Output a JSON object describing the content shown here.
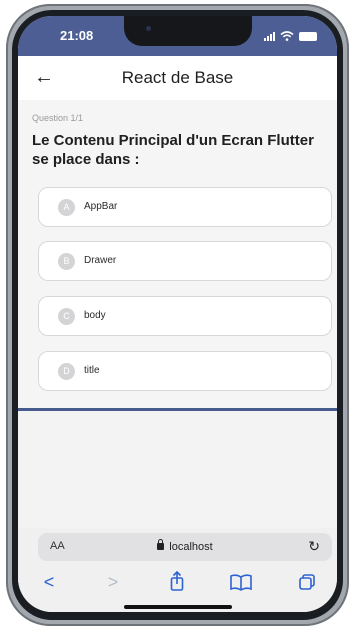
{
  "status_bar": {
    "time": "21:08"
  },
  "app_bar": {
    "back": "←",
    "title": "React de Base"
  },
  "question": {
    "counter": "Question 1/1",
    "text": "Le Contenu Principal d'un Ecran Flutter se place dans :"
  },
  "options": [
    {
      "letter": "A",
      "text": "AppBar"
    },
    {
      "letter": "B",
      "text": "Drawer"
    },
    {
      "letter": "C",
      "text": "body"
    },
    {
      "letter": "D",
      "text": "title"
    }
  ],
  "browser": {
    "aa_label": "AA",
    "url": "localhost",
    "reload": "↻",
    "nav": {
      "back": "<",
      "forward": ">",
      "share": "⇪",
      "bookmarks": "⎕",
      "tabs": "❐"
    }
  },
  "colors": {
    "status_bar": "#4c5e93",
    "divider": "#465a8e",
    "safari_blue": "#2d62d1"
  }
}
